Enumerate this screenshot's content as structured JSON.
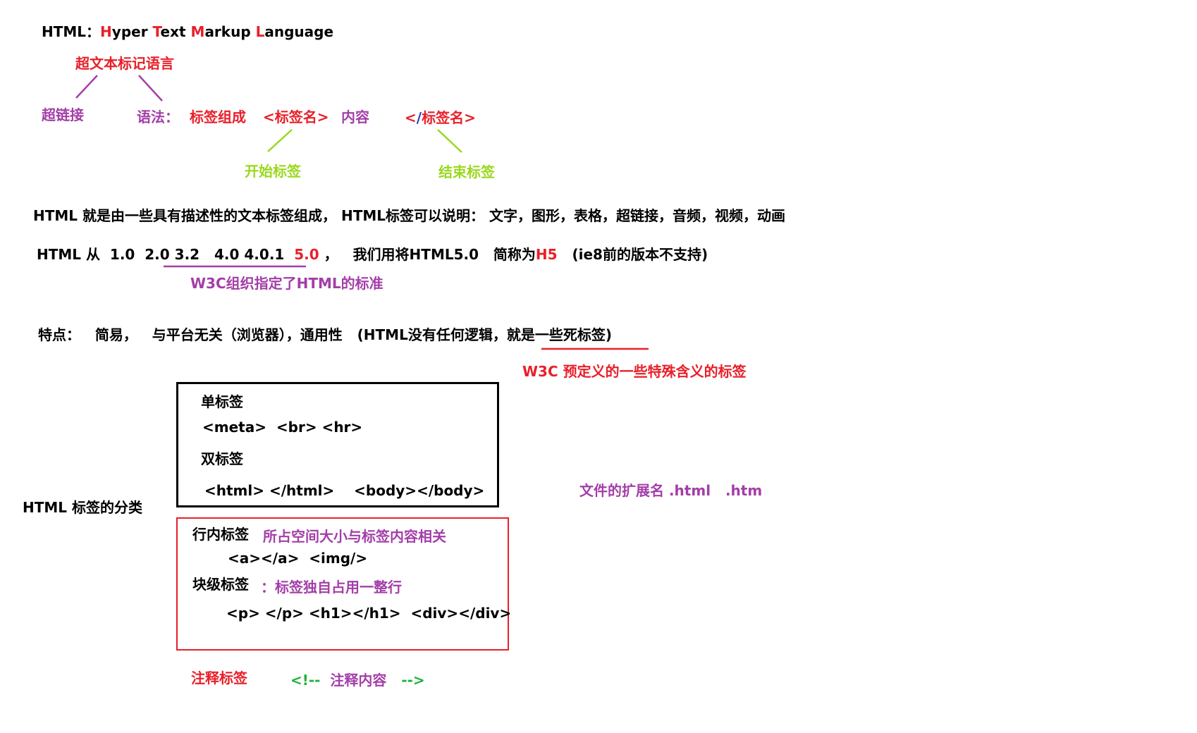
{
  "colors": {
    "purple": "#a33ea8",
    "red": "#e8202a",
    "green": "#9ad81e",
    "green_dark": "#1fb23c",
    "blue": "#2a3fb5",
    "black": "#000000"
  },
  "title": {
    "prefix": "HTML：",
    "h": "H",
    "yper": "yper ",
    "t": "T",
    "ext": "ext ",
    "m": "M",
    "arkup": "arkup ",
    "l": "L",
    "anguage": "anguage"
  },
  "hypertext_label": "超文本标记语言",
  "hyperlink_label": "超链接",
  "syntax": {
    "label": "语法：",
    "composed": "标签组成",
    "open_tag": "<标签名>",
    "content": "内容",
    "close_lt": "<",
    "close_slash": "/",
    "close_rest": "标签名>"
  },
  "start_tag_label": "开始标签",
  "end_tag_label": "结束标签",
  "description": "HTML 就是由一些具有描述性的文本标签组成， HTML标签可以说明： 文字，图形，表格，超链接，音频，视频，动画",
  "versions": {
    "prefix": "HTML 从  1.0  2.0 ",
    "mid": "3.2   4.0 4.0.1  ",
    "v5": "5.0",
    "comma": " ，",
    "use": "我们用将HTML5.0   简称为",
    "h5": "H5",
    "note": "(ie8前的版本不支持)"
  },
  "w3c_standard": "W3C组织指定了HTML的标准",
  "features": "特点：   简易，   与平台无关（浏览器），通用性   (HTML没有任何逻辑，就是一些死标签)",
  "w3c_predefined": "W3C 预定义的一些特殊含义的标签",
  "classification": "HTML 标签的分类",
  "box1": {
    "single_title": "单标签",
    "single_examples": "<meta>  <br> <hr>",
    "double_title": "双标签",
    "double_examples": "<html> </html>    <body></body>"
  },
  "box2": {
    "inline_title": "行内标签",
    "inline_note": "所占空间大小与标签内容相关",
    "inline_examples": "<a></a>  <img/>",
    "block_title": "块级标签",
    "block_note": "：标签独自占用一整行",
    "block_examples": "<p> </p> <h1></h1>  <div></div>"
  },
  "extension": "文件的扩展名 .html   .htm",
  "comment": {
    "title": "注释标签",
    "open": "<!--",
    "content": "注释内容",
    "close": "-->"
  }
}
